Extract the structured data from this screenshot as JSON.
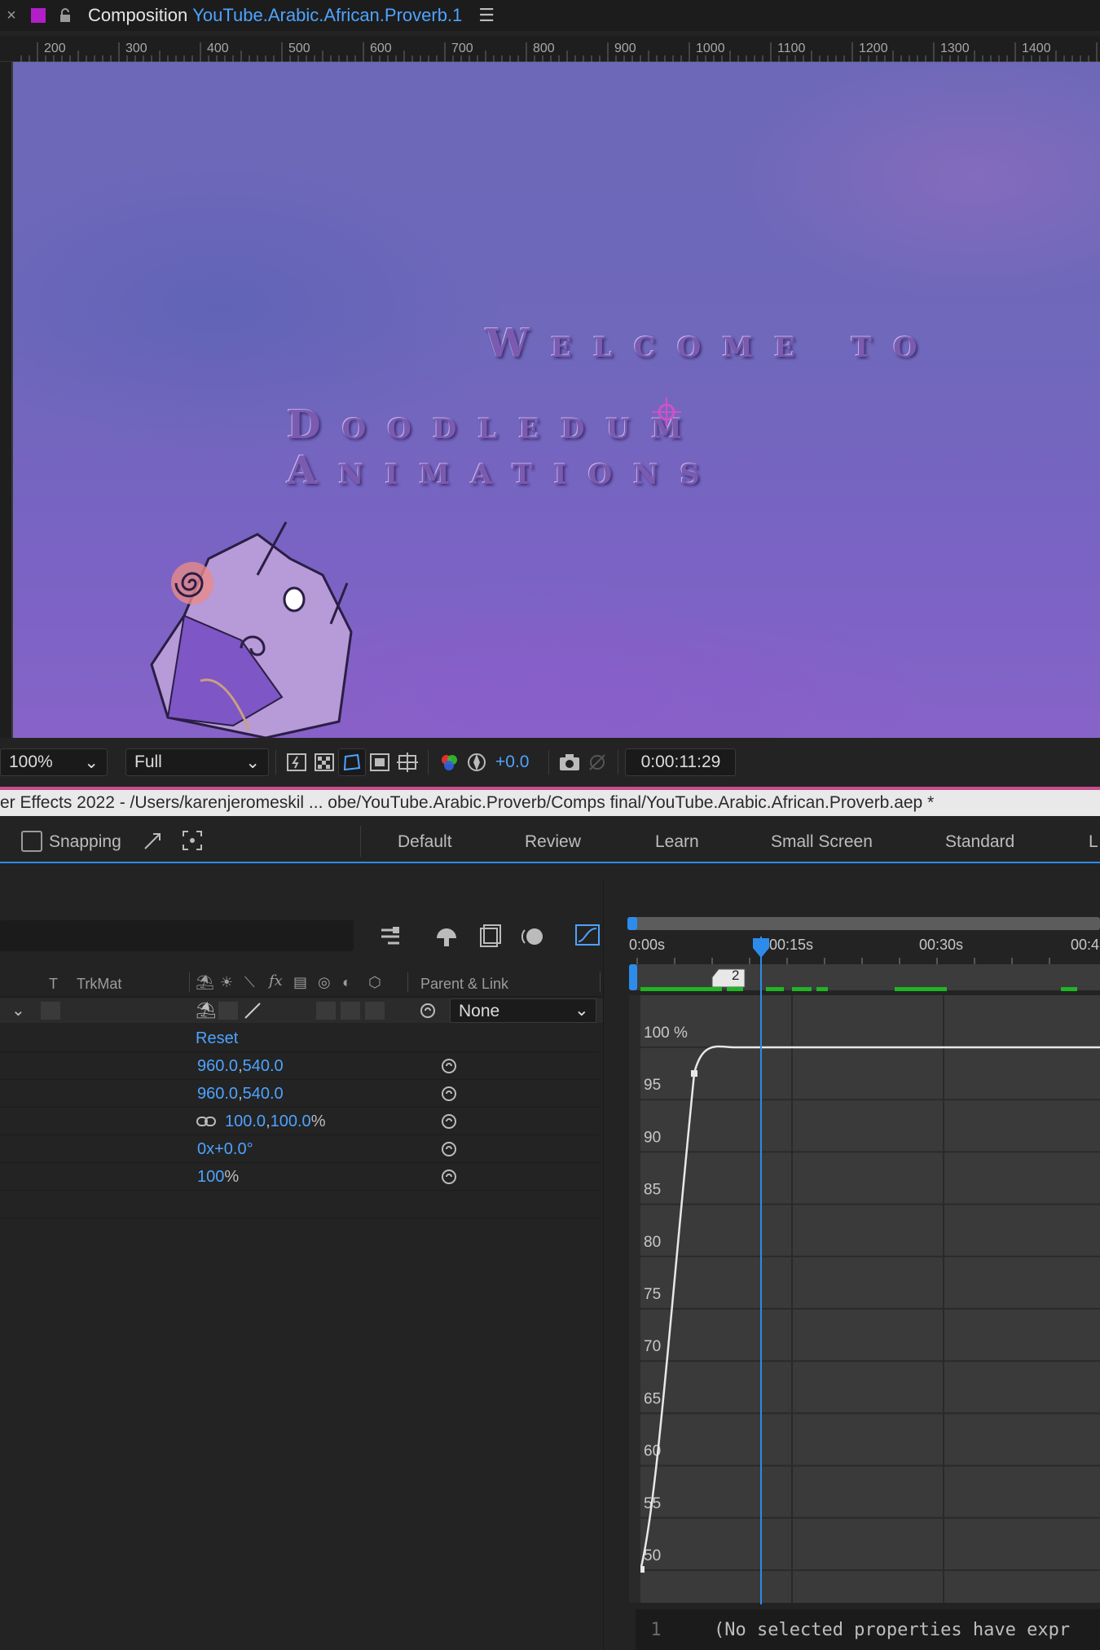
{
  "composition": {
    "title": "Composition",
    "name": "YouTube.Arabic.African.Proverb.1",
    "close_glyph": "×",
    "menu_glyph": "☰",
    "swatch_color": "#b21fc8"
  },
  "ruler": {
    "labels": [
      "200",
      "300",
      "400",
      "500",
      "600",
      "700",
      "800",
      "900",
      "1000",
      "1100",
      "1200",
      "1300",
      "1400"
    ]
  },
  "viewer": {
    "text_line1": "Welcome to",
    "text_line2": "Doodledum Animations"
  },
  "viewer_toolbar": {
    "zoom": "100%",
    "resolution": "Full",
    "exposure": "+0.0",
    "timecode": "0:00:11:29"
  },
  "app_title": "er Effects 2022 - /Users/karenjeromeskil ... obe/YouTube.Arabic.Proverb/Comps final/YouTube.Arabic.African.Proverb.aep *",
  "workspace": {
    "snapping_label": "Snapping",
    "tabs": [
      "Default",
      "Review",
      "Learn",
      "Small Screen",
      "Standard",
      "L"
    ]
  },
  "timeline": {
    "col_t": "T",
    "col_trkmat": "TrkMat",
    "col_parent": "Parent & Link",
    "parent_value": "None",
    "reset_label": "Reset",
    "properties": [
      {
        "a": "960.0",
        "sep": ",",
        "b": "540.0",
        "unit": ""
      },
      {
        "a": "960.0",
        "sep": ",",
        "b": "540.0",
        "unit": ""
      },
      {
        "a": "100.0",
        "sep": ",",
        "b": "100.0",
        "unit": "%"
      },
      {
        "a": "0x",
        "sep": "",
        "b": "+0.0°",
        "unit": ""
      },
      {
        "a": "100",
        "sep": "",
        "b": "",
        "unit": "%"
      }
    ]
  },
  "graph_editor": {
    "time_labels": [
      "0:00s",
      "00:15s",
      "00:30s",
      "00:4"
    ],
    "marker_label": "2",
    "y_labels": [
      "100 %",
      "95",
      "90",
      "85",
      "80",
      "75",
      "70",
      "65",
      "60",
      "55",
      "50"
    ],
    "curve_from": 50,
    "curve_to": 100
  },
  "expression": {
    "line_number": "1",
    "text": "(No selected properties have expr"
  }
}
